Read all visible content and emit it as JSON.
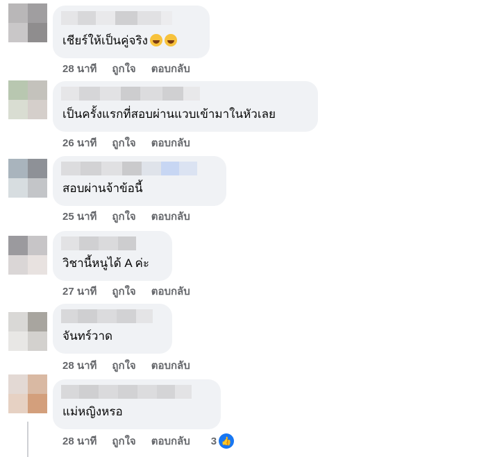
{
  "comments": [
    {
      "text": "เชียร์ให้เป็นคู่จริง",
      "time": "28 นาที",
      "like": "ถูกใจ",
      "reply": "ตอบกลับ",
      "emoji_1": "laughing-emoji",
      "emoji_2": "laughing-emoji"
    },
    {
      "text": "เป็นครั้งแรกที่สอบผ่านแวบเข้ามาในหัวเลย",
      "time": "26 นาที",
      "like": "ถูกใจ",
      "reply": "ตอบกลับ"
    },
    {
      "text": "สอบผ่านจ้าข้อนี้",
      "time": "25 นาที",
      "like": "ถูกใจ",
      "reply": "ตอบกลับ"
    },
    {
      "text": "วิชานี้หนูได้ A ค่ะ",
      "time": "27 นาที",
      "like": "ถูกใจ",
      "reply": "ตอบกลับ"
    },
    {
      "text": "จันทร์วาด",
      "time": "28 นาที",
      "like": "ถูกใจ",
      "reply": "ตอบกลับ"
    },
    {
      "text": "แม่หญิงหรอ",
      "time": "28 นาที",
      "like": "ถูกใจ",
      "reply": "ตอบกลับ",
      "reaction_count": "3",
      "reaction_icon": "thumbs-up-icon"
    }
  ],
  "colors": {
    "bubble_bg": "#f0f2f5",
    "meta_text": "#65676b",
    "like_blue": "#1877f2"
  }
}
